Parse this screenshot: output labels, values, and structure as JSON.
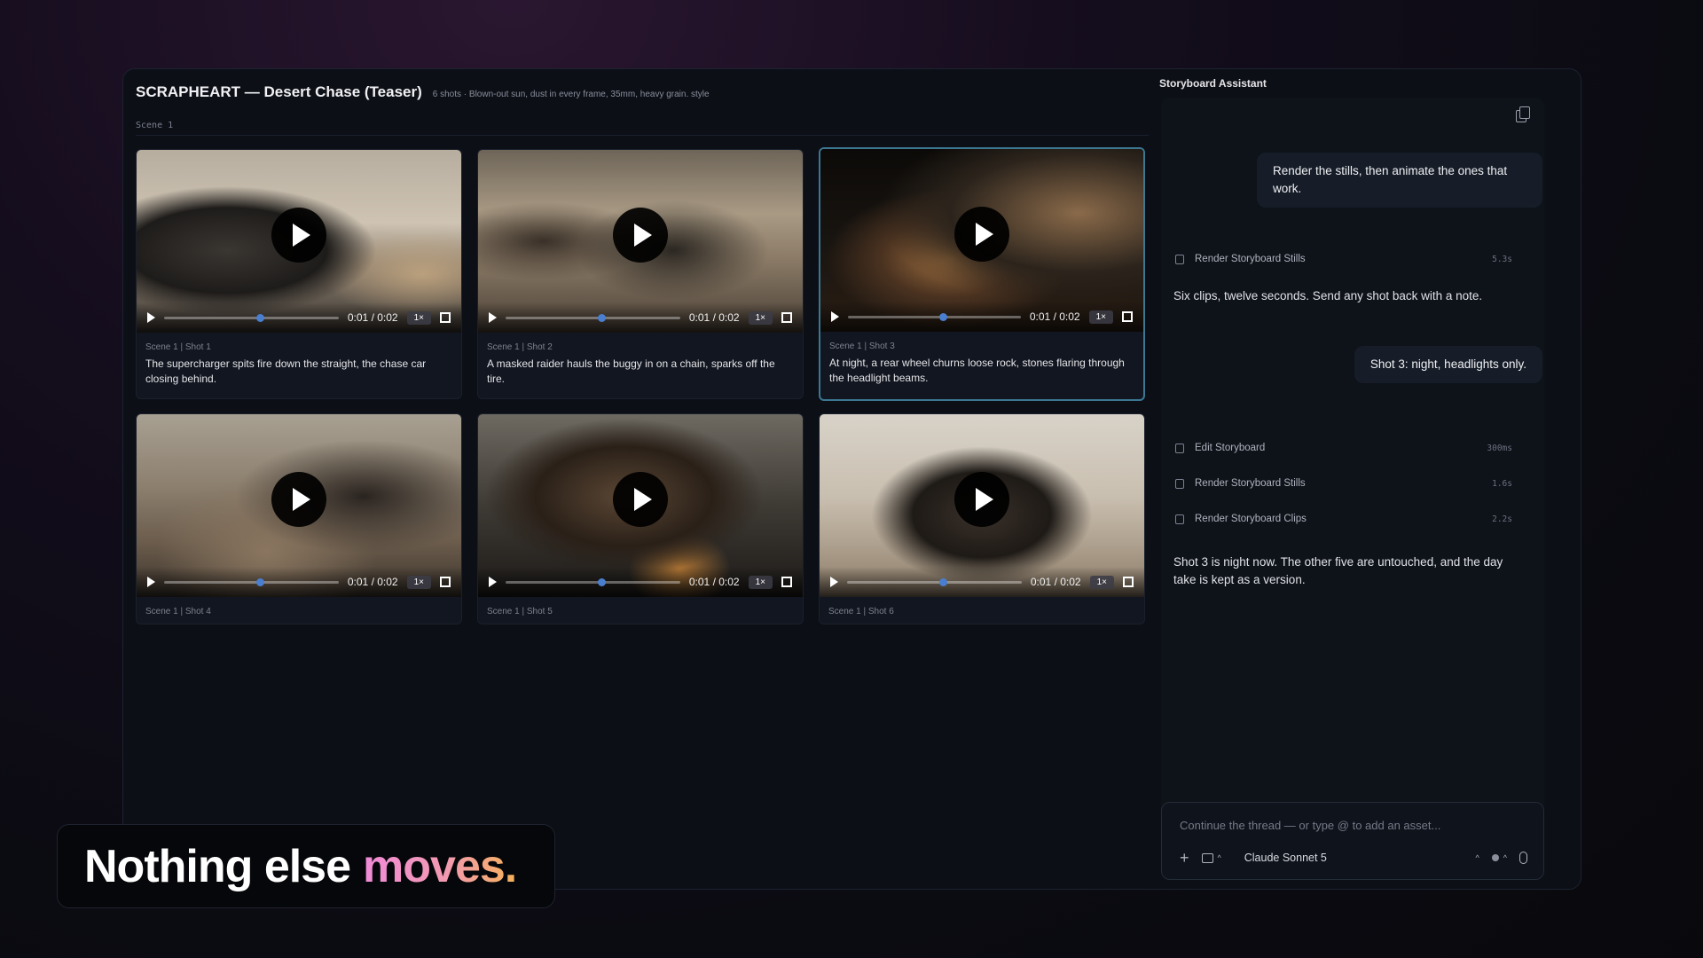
{
  "project": {
    "title": "SCRAPHEART — Desert Chase (Teaser)",
    "subtitle": "6 shots · Blown-out sun, dust in every frame, 35mm, heavy grain. style",
    "scene_label": "Scene 1"
  },
  "shots": [
    {
      "label": "Scene 1 | Shot 1",
      "desc": "The supercharger spits fire down the straight, the chase car closing behind.",
      "time": "0:01 / 0:02",
      "speed": "1×",
      "progress": 0.55,
      "selected": false
    },
    {
      "label": "Scene 1 | Shot 2",
      "desc": "A masked raider hauls the buggy in on a chain, sparks off the tire.",
      "time": "0:01 / 0:02",
      "speed": "1×",
      "progress": 0.55,
      "selected": false
    },
    {
      "label": "Scene 1 | Shot 3",
      "desc": "At night, a rear wheel churns loose rock, stones flaring through the headlight beams.",
      "time": "0:01 / 0:02",
      "speed": "1×",
      "progress": 0.55,
      "selected": true
    },
    {
      "label": "Scene 1 | Shot 4",
      "desc": "",
      "time": "0:01 / 0:02",
      "speed": "1×",
      "progress": 0.55,
      "selected": false
    },
    {
      "label": "Scene 1 | Shot 5",
      "desc": "",
      "time": "0:01 / 0:02",
      "speed": "1×",
      "progress": 0.55,
      "selected": false
    },
    {
      "label": "Scene 1 | Shot 6",
      "desc": "",
      "time": "0:01 / 0:02",
      "speed": "1×",
      "progress": 0.55,
      "selected": false
    }
  ],
  "assistant": {
    "title": "Storyboard Assistant",
    "user_msg_1": "Render the stills, then animate the ones that work.",
    "tool_1": {
      "label": "Render Storyboard Stills",
      "duration": "5.3s"
    },
    "reply_1": "Six clips, twelve seconds. Send any shot back with a note.",
    "user_msg_2": "Shot 3: night, headlights only.",
    "tool_2": {
      "label": "Edit Storyboard",
      "duration": "300ms"
    },
    "tool_3": {
      "label": "Render Storyboard Stills",
      "duration": "1.6s"
    },
    "tool_4": {
      "label": "Render Storyboard Clips",
      "duration": "2.2s"
    },
    "reply_2": "Shot 3 is night now. The other five are untouched, and the day take is kept as a version.",
    "composer_placeholder": "Continue the thread — or type @ to add an asset...",
    "model": "Claude Sonnet 5"
  },
  "caption": {
    "lead": "Nothing else",
    "accent": "moves."
  },
  "colors": {
    "selected_border": "#3c7792",
    "progress_knob": "#4a7fd0",
    "accent_gradient_start": "#f08ad8",
    "accent_gradient_end": "#f5b15a"
  },
  "icons": [
    "play-icon",
    "fullscreen-icon",
    "copy-icon",
    "document-icon",
    "plus-icon",
    "chat-icon",
    "chevron-up-icon",
    "mic-icon"
  ]
}
